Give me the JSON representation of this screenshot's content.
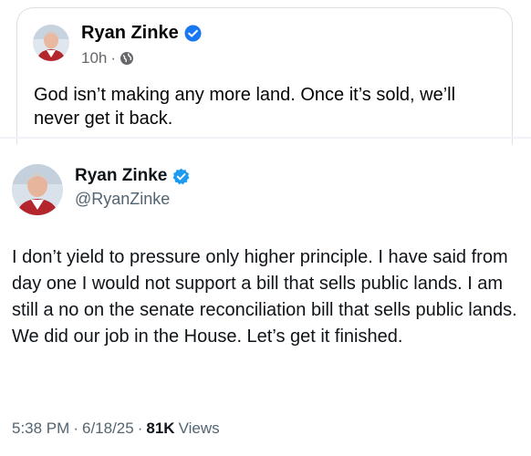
{
  "facebook_post": {
    "author_name": "Ryan Zinke",
    "time": "10h",
    "separator": "·",
    "audience_icon": "globe-icon",
    "verified_icon": "verified-badge-icon",
    "verified_color": "#1877f2",
    "text": "God isn’t making any more land. Once it’s sold, we’ll never get it back."
  },
  "x_post": {
    "author_name": "Ryan Zinke",
    "handle": "@RyanZinke",
    "verified_icon": "verified-badge-icon",
    "verified_color": "#1d9bf0",
    "text": "I don’t yield to pressure only higher principle.  I have said from day one I would not support a bill that sells public lands. I am still a no on the senate reconciliation bill that sells public lands. We did our job in the House. Let’s get it finished.",
    "time": "5:38 PM",
    "date": "6/18/25",
    "separator": "·",
    "views_count": "81K",
    "views_label": "Views"
  }
}
